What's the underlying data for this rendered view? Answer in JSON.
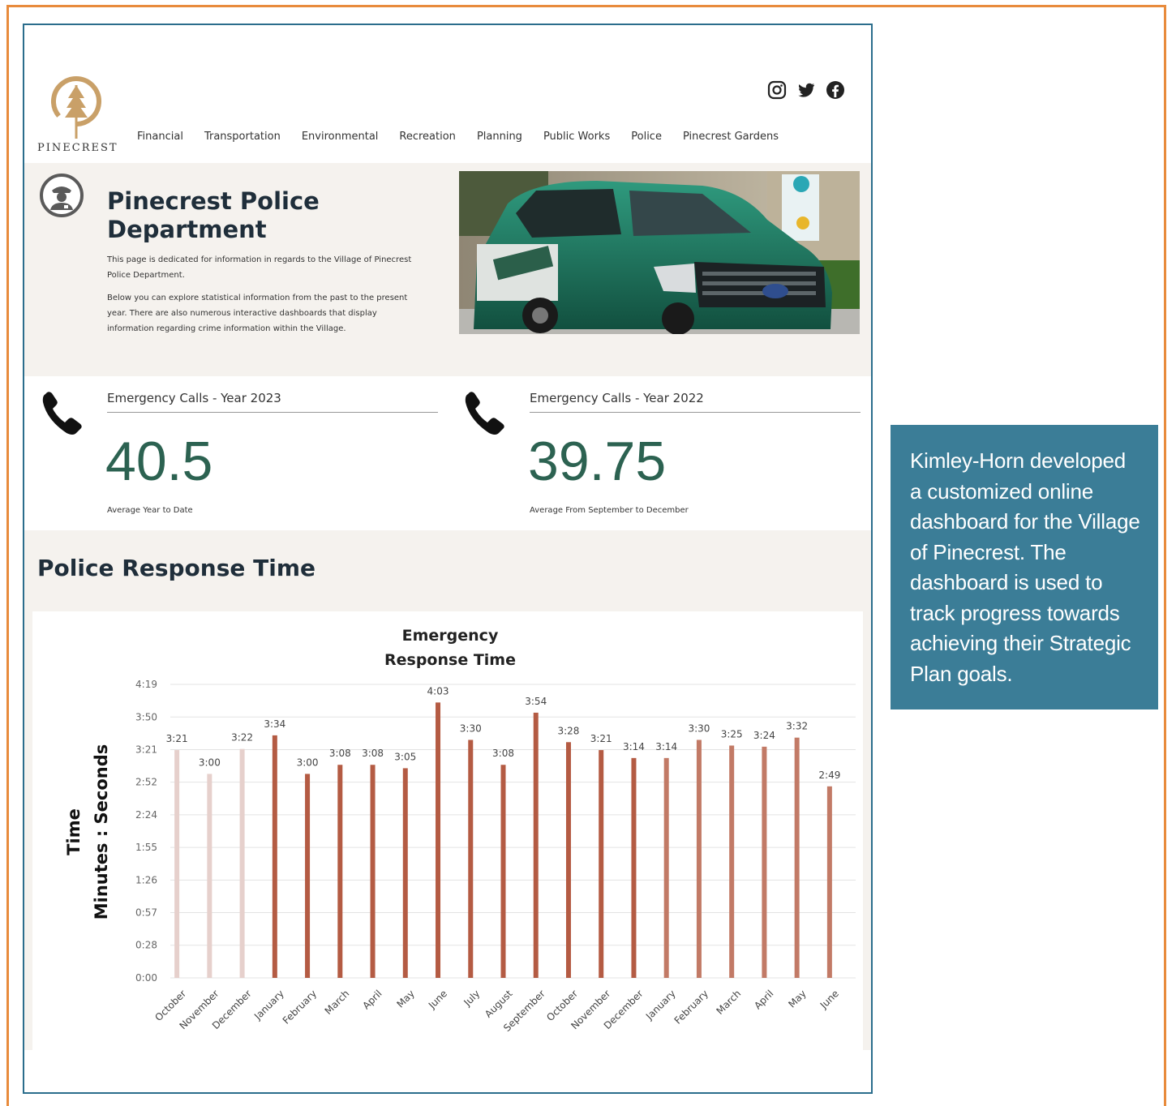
{
  "site": {
    "logo_text": "PINECREST",
    "nav": [
      "Financial",
      "Transportation",
      "Environmental",
      "Recreation",
      "Planning",
      "Public Works",
      "Police",
      "Pinecrest Gardens"
    ],
    "social_icons": [
      "instagram-icon",
      "twitter-icon",
      "facebook-icon"
    ]
  },
  "hero": {
    "title": "Pinecrest Police Department",
    "paragraph_1": "This page is dedicated for information in regards to the Village of Pinecrest Police Department.",
    "paragraph_2": "Below you can explore statistical information from the past to the present year. There are also numerous interactive dashboards that display information regarding crime information within the Village.",
    "photo_alt": "Pinecrest police SUV"
  },
  "stats": [
    {
      "label": "Emergency Calls - Year 2023",
      "value": "40.5",
      "note": "Average Year to Date"
    },
    {
      "label": "Emergency Calls - Year 2022",
      "value": "39.75",
      "note": "Average From September to December"
    }
  ],
  "section": {
    "title": "Police Response Time"
  },
  "chart_data": {
    "type": "bar",
    "title": "Emergency Response Time",
    "ylabel": "Time Minutes : Seconds",
    "ylabel_lines": [
      "Time",
      "Minutes : Seconds"
    ],
    "xlabel": "",
    "ylim": [
      0,
      259
    ],
    "y_ticks": [
      0,
      28.8,
      57.6,
      86.3,
      115.1,
      143.9,
      172.7,
      201.4,
      230.2,
      259
    ],
    "y_tick_labels": [
      "0:00",
      "0:28",
      "0:57",
      "1:26",
      "1:55",
      "2:24",
      "2:52",
      "3:21",
      "3:50",
      "4:19"
    ],
    "grid": true,
    "categories": [
      "October",
      "November",
      "December",
      "January",
      "February",
      "March",
      "April",
      "May",
      "June",
      "July",
      "August",
      "September",
      "October",
      "November",
      "December",
      "January",
      "February",
      "March",
      "April",
      "May",
      "June"
    ],
    "values": [
      201,
      180,
      202,
      214,
      180,
      188,
      188,
      185,
      243,
      210,
      188,
      234,
      208,
      201,
      194,
      194,
      210,
      205,
      204,
      212,
      169
    ],
    "data_labels": [
      "3:21",
      "3:00",
      "3:22",
      "3:34",
      "3:00",
      "3:08",
      "3:08",
      "3:05",
      "4:03",
      "3:30",
      "3:08",
      "3:54",
      "3:28",
      "3:21",
      "3:14",
      "3:14",
      "3:30",
      "3:25",
      "3:24",
      "3:32",
      "2:49"
    ],
    "bar_colors": [
      "#e6d0cc",
      "#e6d0cc",
      "#e6d0cc",
      "#b45b43",
      "#b45b43",
      "#b45b43",
      "#b45b43",
      "#b45b43",
      "#b45b43",
      "#b45b43",
      "#b45b43",
      "#b45b43",
      "#b45b43",
      "#b45b43",
      "#b45b43",
      "#c27a66",
      "#c27a66",
      "#c27a66",
      "#c27a66",
      "#c27a66",
      "#c27a66"
    ]
  },
  "caption": {
    "text": "Kimley-Horn developed a customized online dashboard for the Village of Pinecrest. The dashboard is used to track progress towards achieving their Strategic Plan goals."
  },
  "colors": {
    "frame": "#e88b3c",
    "screen_border": "#2b6d8c",
    "stat_value": "#2c6251",
    "caption_bg": "#3b7d97"
  }
}
